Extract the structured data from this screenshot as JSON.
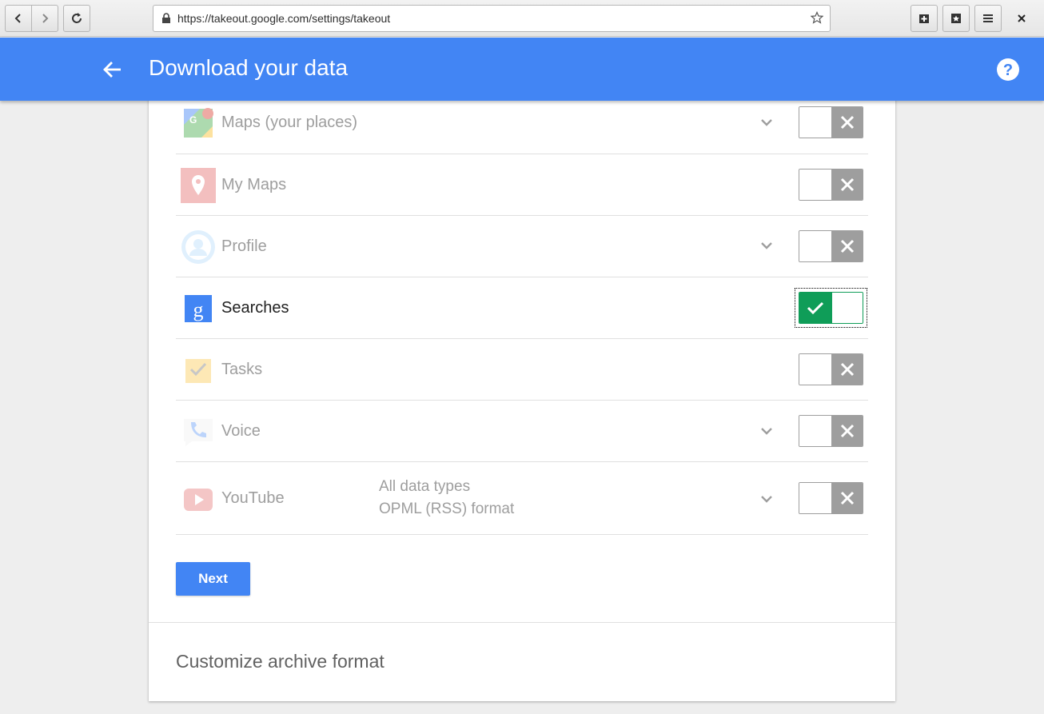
{
  "browser": {
    "url": "https://takeout.google.com/settings/takeout"
  },
  "header": {
    "title": "Download your data"
  },
  "products": [
    {
      "name": "Maps (your places)",
      "has_chevron": true,
      "enabled": false,
      "icon": "google-maps-icon"
    },
    {
      "name": "My Maps",
      "has_chevron": false,
      "enabled": false,
      "icon": "my-maps-pin-icon"
    },
    {
      "name": "Profile",
      "has_chevron": true,
      "enabled": false,
      "icon": "profile-avatar-icon"
    },
    {
      "name": "Searches",
      "has_chevron": false,
      "enabled": true,
      "icon": "google-search-icon"
    },
    {
      "name": "Tasks",
      "has_chevron": false,
      "enabled": false,
      "icon": "tasks-checkbox-icon"
    },
    {
      "name": "Voice",
      "has_chevron": true,
      "enabled": false,
      "icon": "voice-phone-icon"
    },
    {
      "name": "YouTube",
      "has_chevron": true,
      "enabled": false,
      "icon": "youtube-play-icon",
      "details": [
        "All data types",
        "OPML (RSS) format"
      ]
    }
  ],
  "actions": {
    "next_label": "Next"
  },
  "sections": {
    "customize_title": "Customize archive format"
  },
  "colors": {
    "header_bg": "#4285f4",
    "toggle_on": "#0f9d58",
    "toggle_off": "#9e9e9e"
  }
}
